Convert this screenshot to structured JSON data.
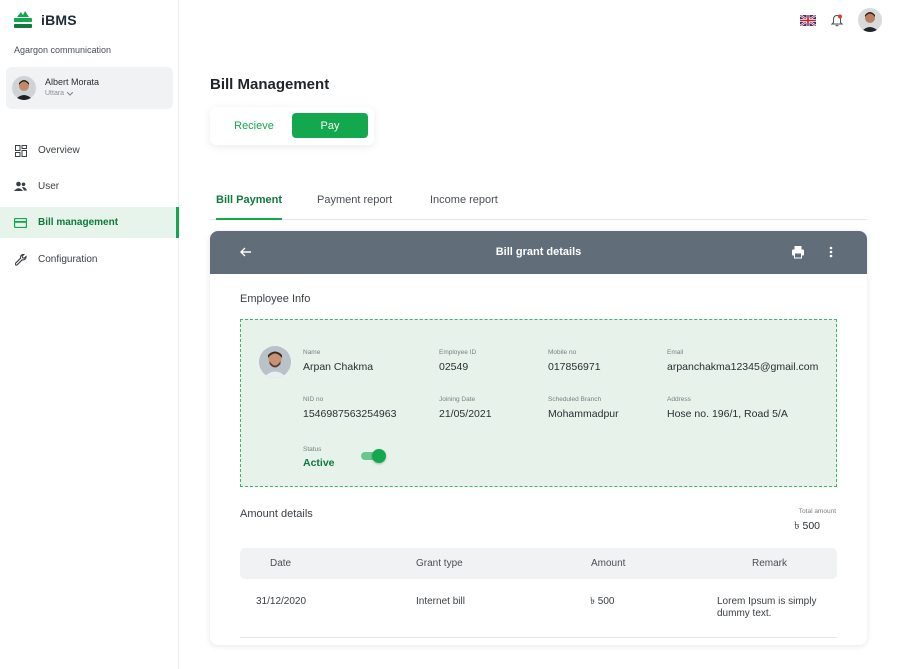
{
  "app": {
    "name": "iBMS",
    "org": "Agargon communication"
  },
  "user": {
    "name": "Albert Morata",
    "location": "Uttara"
  },
  "nav": [
    {
      "label": "Overview",
      "icon": "grid-icon"
    },
    {
      "label": "User",
      "icon": "users-icon"
    },
    {
      "label": "Bill management",
      "icon": "card-icon",
      "active": true
    },
    {
      "label": "Configuration",
      "icon": "wrench-icon"
    }
  ],
  "page": {
    "title": "Bill Management"
  },
  "segment": {
    "options": [
      "Recieve",
      "Pay"
    ],
    "selected": "Pay"
  },
  "tabs": [
    "Bill Payment",
    "Payment report",
    "Income report"
  ],
  "active_tab": "Bill Payment",
  "card": {
    "title": "Bill grant details"
  },
  "employee": {
    "section_title": "Employee Info",
    "labels": {
      "name": "Name",
      "employee_id": "Employee ID",
      "mobile": "Mobile no",
      "email": "Email",
      "nid": "NID no",
      "joining": "Joining Date",
      "branch": "Scheduled Branch",
      "address": "Address",
      "status": "Status"
    },
    "values": {
      "name": "Arpan Chakma",
      "employee_id": "02549",
      "mobile": "017856971",
      "email": "arpanchakma12345@gmail.com",
      "nid": "1546987563254963",
      "joining": "21/05/2021",
      "branch": "Mohammadpur",
      "address": "Hose no. 196/1, Road 5/A",
      "status": "Active"
    },
    "status_on": true
  },
  "amount": {
    "section_title": "Amount details",
    "total_label": "Total amount",
    "total_value": "৳ 500",
    "columns": [
      "Date",
      "Grant type",
      "Amount",
      "Remark"
    ],
    "rows": [
      {
        "date": "31/12/2020",
        "grant_type": "Internet bill",
        "amount": "৳ 500",
        "remark_line1": "Lorem Ipsum is simply",
        "remark_line2": "dummy text."
      }
    ]
  },
  "colors": {
    "brand": "#14a84e",
    "header": "#616e79",
    "panel": "#e6f2ea"
  }
}
